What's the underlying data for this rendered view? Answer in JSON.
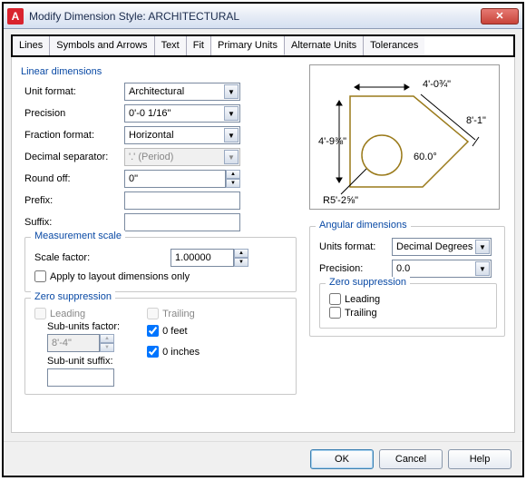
{
  "window": {
    "title": "Modify Dimension Style: ARCHITECTURAL",
    "close": "✕",
    "app_letter": "A"
  },
  "tabs": [
    "Lines",
    "Symbols and Arrows",
    "Text",
    "Fit",
    "Primary Units",
    "Alternate Units",
    "Tolerances"
  ],
  "linear": {
    "heading": "Linear dimensions",
    "unit_format_label": "Unit format:",
    "unit_format_value": "Architectural",
    "precision_label": "Precision",
    "precision_value": "0'-0 1/16\"",
    "fraction_label": "Fraction format:",
    "fraction_value": "Horizontal",
    "decimal_sep_label": "Decimal separator:",
    "decimal_sep_value": "'.' (Period)",
    "roundoff_label": "Round off:",
    "roundoff_value": "0\"",
    "prefix_label": "Prefix:",
    "prefix_value": "",
    "suffix_label": "Suffix:",
    "suffix_value": ""
  },
  "measurement": {
    "title": "Measurement scale",
    "scale_label": "Scale factor:",
    "scale_value": "1.00000",
    "apply_label": "Apply to layout dimensions only",
    "apply_checked": false
  },
  "zero": {
    "title": "Zero suppression",
    "leading": "Leading",
    "trailing": "Trailing",
    "subunits_factor_label": "Sub-units factor:",
    "subunits_factor_value": "8'-4\"",
    "subunit_suffix_label": "Sub-unit suffix:",
    "subunit_suffix_value": "",
    "ofeet": "0 feet",
    "oinches": "0 inches"
  },
  "angular": {
    "title": "Angular dimensions",
    "units_label": "Units format:",
    "units_value": "Decimal Degrees",
    "precision_label": "Precision:",
    "precision_value": "0.0",
    "zero_title": "Zero suppression",
    "leading": "Leading",
    "trailing": "Trailing"
  },
  "preview_labels": {
    "top": "4'-0¾\"",
    "left": "4'-9⅜\"",
    "right": "8'-1\"",
    "angle": "60.0°",
    "radius": "R5'-2⅝\""
  },
  "buttons": {
    "ok": "OK",
    "cancel": "Cancel",
    "help": "Help"
  }
}
